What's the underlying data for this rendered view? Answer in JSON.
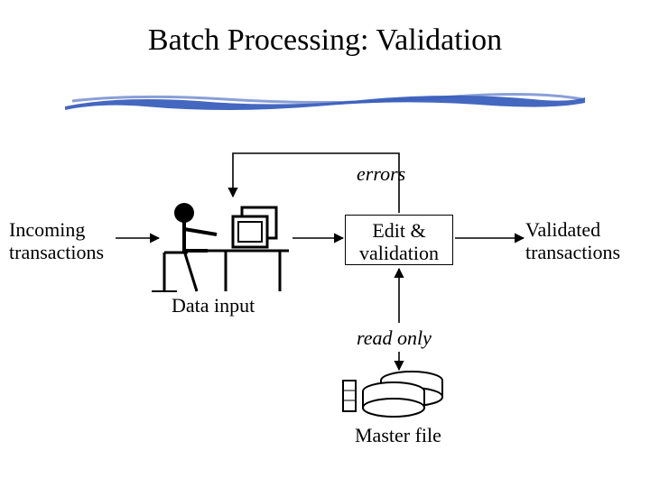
{
  "title": "Batch Processing: Validation",
  "labels": {
    "errors": "errors",
    "incoming": "Incoming\ntransactions",
    "validated": "Validated\ntransactions",
    "data_input": "Data input",
    "read_only": "read only",
    "master_file": "Master file"
  },
  "process": {
    "edit_validation": "Edit &\nvalidation"
  }
}
